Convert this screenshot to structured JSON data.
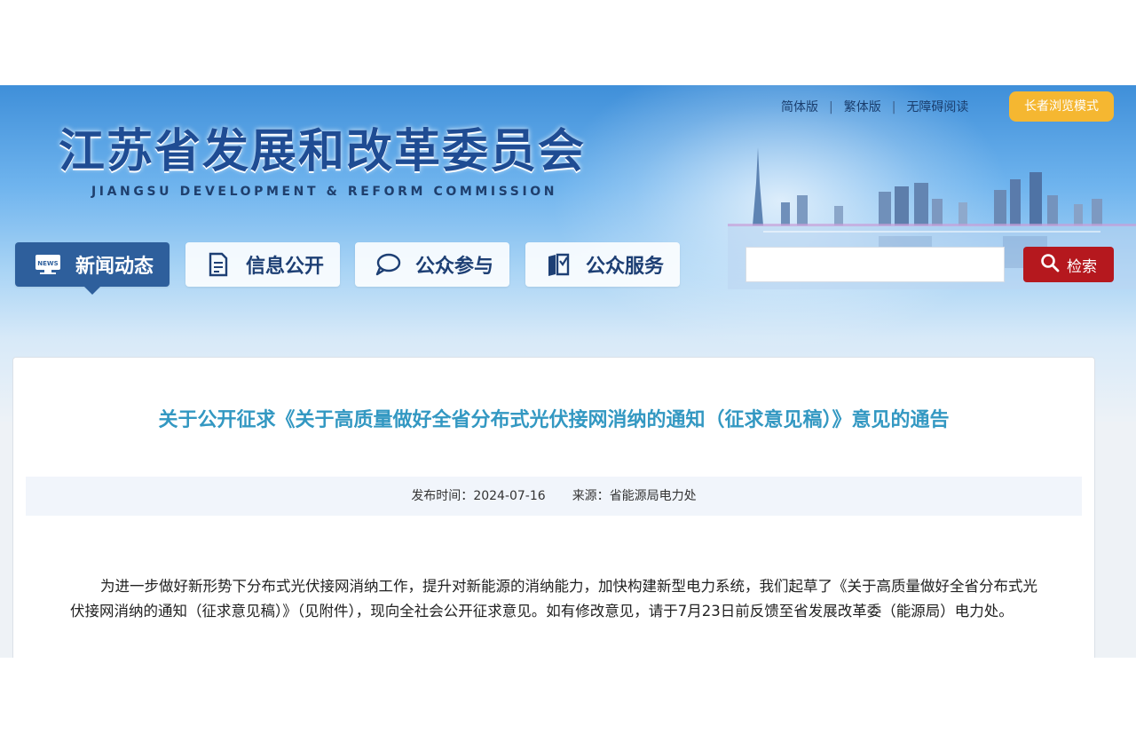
{
  "header": {
    "site_name_cn": "江苏省发展和改革委员会",
    "site_name_en": "JIANGSU DEVELOPMENT & REFORM COMMISSION",
    "top_links": {
      "simplified": "简体版",
      "traditional": "繁体版",
      "accessible": "无障碍阅读",
      "separator": "|"
    },
    "elder_mode_label": "长者浏览模式"
  },
  "nav": {
    "items": [
      {
        "label": "新闻动态",
        "icon": "news-icon",
        "active": true
      },
      {
        "label": "信息公开",
        "icon": "document-icon",
        "active": false
      },
      {
        "label": "公众参与",
        "icon": "chat-bubble-icon",
        "active": false
      },
      {
        "label": "公众服务",
        "icon": "book-icon",
        "active": false
      }
    ],
    "news_icon_text": "NEWS"
  },
  "search": {
    "placeholder": "",
    "button_label": "检索"
  },
  "article": {
    "title": "关于公开征求《关于高质量做好全省分布式光伏接网消纳的通知（征求意见稿）》意见的通告",
    "publish_label": "发布时间：",
    "publish_date": "2024-07-16",
    "source_label": "来源：",
    "source": "省能源局电力处",
    "body": "为进一步做好新形势下分布式光伏接网消纳工作，提升对新能源的消纳能力，加快构建新型电力系统，我们起草了《关于高质量做好全省分布式光伏接网消纳的通知（征求意见稿）》（见附件），现向全社会公开征求意见。如有修改意见，请于7月23日前反馈至省发展改革委（能源局）电力处。"
  },
  "colors": {
    "nav_active": "#2e5f9c",
    "title_blue": "#3398c2",
    "search_red": "#b5181e",
    "elder_yellow": "#f5b731"
  }
}
